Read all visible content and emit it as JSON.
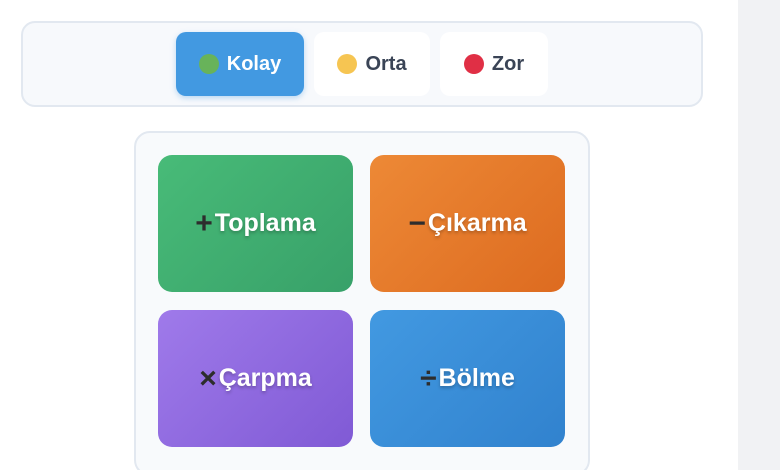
{
  "difficulty": {
    "options": [
      {
        "label": "Kolay",
        "dot_color": "#68b35a",
        "active": true
      },
      {
        "label": "Orta",
        "dot_color": "#f6c552",
        "active": false
      },
      {
        "label": "Zor",
        "dot_color": "#e02f45",
        "active": false
      }
    ]
  },
  "operations": [
    {
      "symbol": "+",
      "label": "Toplama",
      "icon": "plus-icon",
      "color": "#48bb78"
    },
    {
      "symbol": "−",
      "label": "Çıkarma",
      "icon": "minus-icon",
      "color": "#ed8936"
    },
    {
      "symbol": "×",
      "label": "Çarpma",
      "icon": "multiply-icon",
      "color": "#9f7aea"
    },
    {
      "symbol": "÷",
      "label": "Bölme",
      "icon": "divide-icon",
      "color": "#4299e1"
    }
  ]
}
